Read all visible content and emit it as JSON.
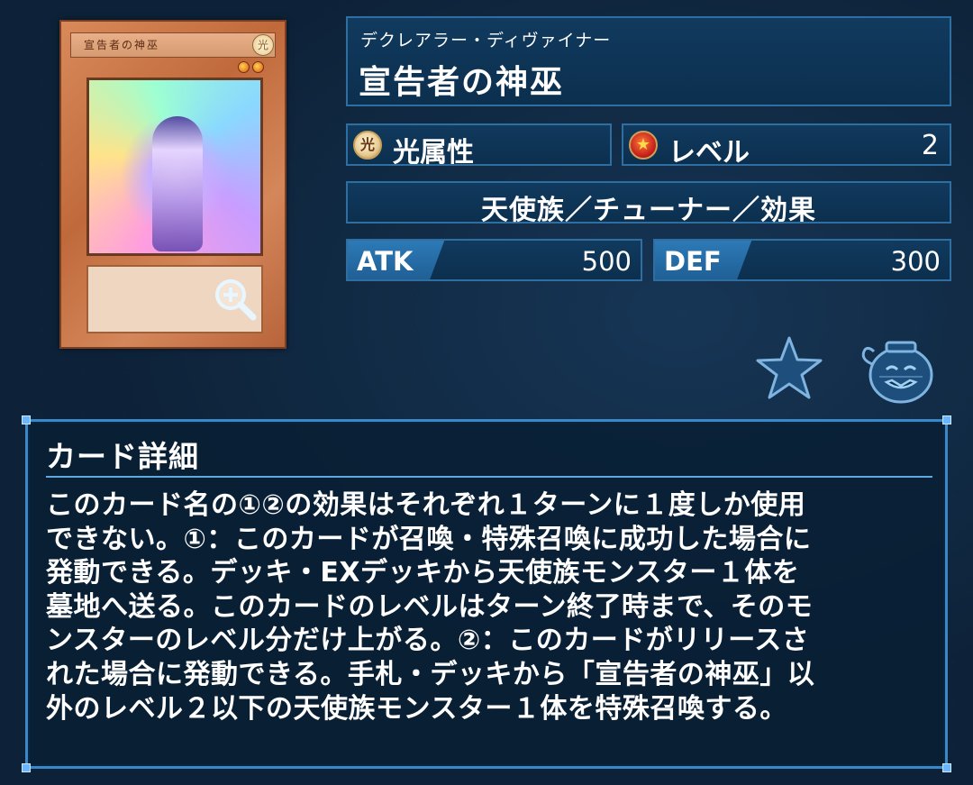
{
  "card": {
    "plate_name": "宣告者の神巫",
    "attribute_mini": "光",
    "footer": "",
    "zoom_icon": "magnifier-plus-icon"
  },
  "header": {
    "reading": "デクレアラー・ディヴァイナー",
    "title": "宣告者の神巫"
  },
  "stats": {
    "attribute_icon_glyph": "光",
    "attribute": "光属性",
    "level_icon_glyph": "★",
    "level_label": "レベル",
    "level": "2",
    "type": "天使族／チューナー／効果",
    "atk_label": "ATK",
    "atk": "500",
    "def_label": "DEF",
    "def": "300"
  },
  "actions": {
    "favorite_icon": "star-icon",
    "pot_icon": "pot-of-greed-icon"
  },
  "details": {
    "title": "カード詳細",
    "text": "このカード名の①②の効果はそれぞれ１ターンに１度しか使用\nできない。①：このカードが召喚・特殊召喚に成功した場合に\n発動できる。デッキ・EXデッキから天使族モンスター１体を\n墓地へ送る。このカードのレベルはターン終了時まで、そのモ\nンスターのレベル分だけ上がる。②：このカードがリリースさ\nれた場合に発動できる。手札・デッキから「宣告者の神巫」以\n外のレベル２以下の天使族モンスター１体を特殊召喚する。"
  },
  "colors": {
    "background": "#0d2238",
    "panel_border": "#2f6ea0",
    "accent": "#2d7bb8"
  }
}
